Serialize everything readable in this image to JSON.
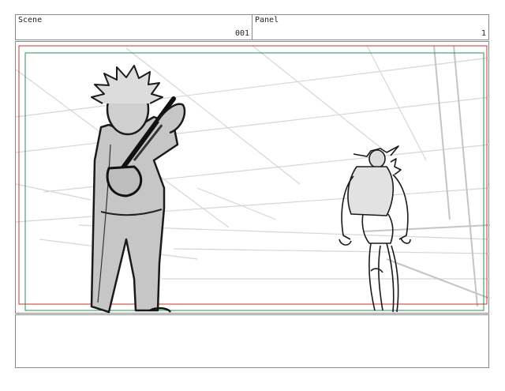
{
  "header": {
    "scene_label": "Scene",
    "scene_value": "001",
    "panel_label": "Panel",
    "panel_value": "1"
  },
  "notes": {
    "text": ""
  },
  "colors": {
    "safe_area_red": "#c0392b",
    "safe_area_green": "#2e8b57",
    "sketch_fill": "#c8c8c8",
    "sketch_line": "#1a1a1a",
    "perspective_line": "#d9d9d9"
  }
}
